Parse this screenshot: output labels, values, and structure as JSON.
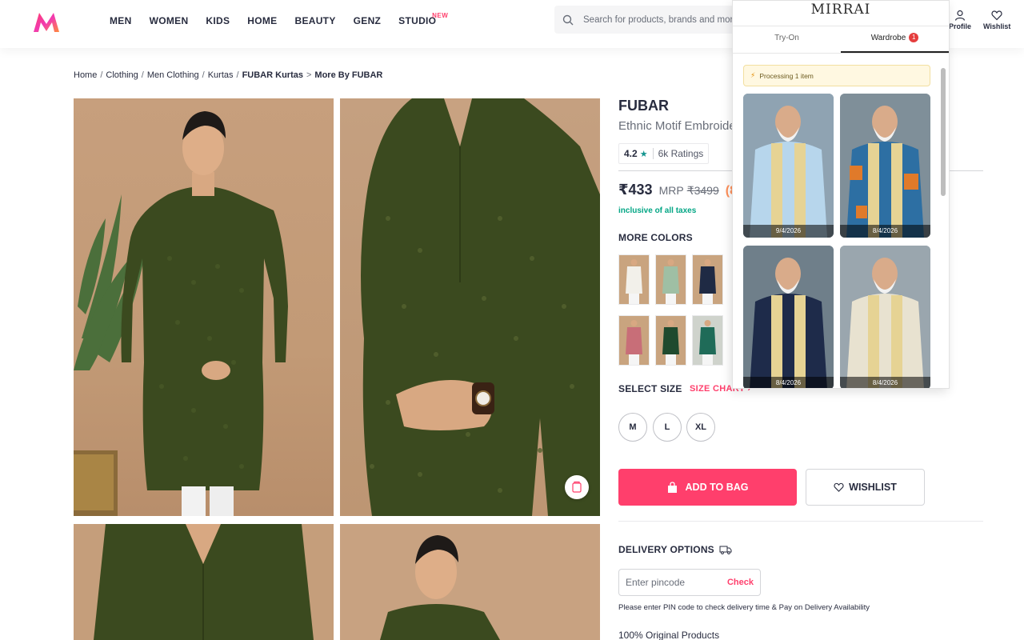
{
  "header": {
    "nav": [
      "MEN",
      "WOMEN",
      "KIDS",
      "HOME",
      "BEAUTY",
      "GENZ",
      "STUDIO"
    ],
    "studio_badge": "NEW",
    "search_placeholder": "Search for products, brands and more",
    "profile_label": "Profile",
    "wishlist_label": "Wishlist"
  },
  "breadcrumb": {
    "items": [
      "Home",
      "Clothing",
      "Men Clothing",
      "Kurtas"
    ],
    "current": "FUBAR Kurtas",
    "more": "More By FUBAR",
    "sep": "/",
    "sep_more": ">"
  },
  "product": {
    "brand": "FUBAR",
    "name": "Ethnic Motif Embroide",
    "rating": "4.2",
    "rating_count": "6k Ratings",
    "price": "₹433",
    "mrp_label": "MRP",
    "mrp": "₹3499",
    "discount": "(8",
    "tax_note": "inclusive of all taxes",
    "more_colors_title": "MORE COLORS",
    "select_size_title": "SELECT SIZE",
    "size_chart": "SIZE CHART",
    "sizes": [
      "M",
      "L",
      "XL"
    ],
    "add_to_bag": "ADD TO BAG",
    "wishlist": "WISHLIST",
    "delivery_title": "DELIVERY OPTIONS",
    "pincode_placeholder": "Enter pincode",
    "check": "Check",
    "pin_note": "Please enter PIN code to check delivery time & Pay on Delivery Availability",
    "original": "100% Original Products"
  },
  "colors": {
    "swatches": [
      "white",
      "sage",
      "navy",
      "rose",
      "green",
      "teal"
    ],
    "swatch_hex": [
      "#f2f0ea",
      "#9fbfa4",
      "#1f2a44",
      "#c86e78",
      "#1f4a2e",
      "#1f6b58"
    ]
  },
  "panel": {
    "logo": "MIRRAI",
    "tab_tryon": "Try-On",
    "tab_wardrobe": "Wardrobe",
    "wardrobe_count": "1",
    "processing": "Processing 1 item",
    "cards": [
      {
        "date": "9/4/2026",
        "color": "#b7d6ec"
      },
      {
        "date": "8/4/2026",
        "color": "#2d6fa3"
      },
      {
        "date": "8/4/2026",
        "color": "#1e2b4a"
      },
      {
        "date": "8/4/2026",
        "color": "#e8e2d0"
      }
    ]
  },
  "colors_theme": {
    "accent": "#ff3f6c",
    "green_text": "#03a685",
    "discount": "#ff905a",
    "kurta": "#3b4a1f"
  }
}
